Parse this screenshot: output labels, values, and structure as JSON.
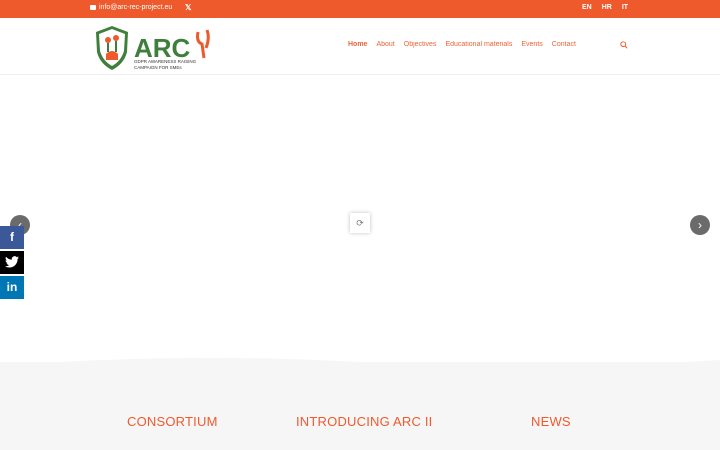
{
  "topbar": {
    "email": "info@arc-rec-project.eu",
    "x_label": "𝕏",
    "languages": [
      "EN",
      "HR",
      "IT"
    ]
  },
  "logo": {
    "text": "ARC",
    "tagline_line1": "GDPR AWARENESS RAISING",
    "tagline_line2": "CAMPAIGN FOR SMEs"
  },
  "nav": {
    "items": [
      {
        "label": "Home",
        "active": true
      },
      {
        "label": "About"
      },
      {
        "label": "Objectives"
      },
      {
        "label": "Educational materials"
      },
      {
        "label": "Events"
      },
      {
        "label": "Contact"
      }
    ]
  },
  "icons": {
    "search": "search-icon",
    "prev": "chevron-left-icon",
    "next": "chevron-right-icon",
    "loader": "loader-icon",
    "facebook": "facebook-icon",
    "twitter": "twitter-icon",
    "linkedin": "linkedin-icon"
  },
  "social": {
    "facebook": "f",
    "linkedin": "in"
  },
  "slider_arrows": {
    "left": "‹",
    "right": "›"
  },
  "sections": [
    {
      "title": "CONSORTIUM"
    },
    {
      "title": "INTRODUCING ARC II"
    },
    {
      "title": "NEWS"
    }
  ],
  "colors": {
    "accent": "#ef5a2d",
    "green": "#3f7f3c",
    "social_facebook": "#3b5998",
    "social_linkedin": "#0077b5"
  }
}
